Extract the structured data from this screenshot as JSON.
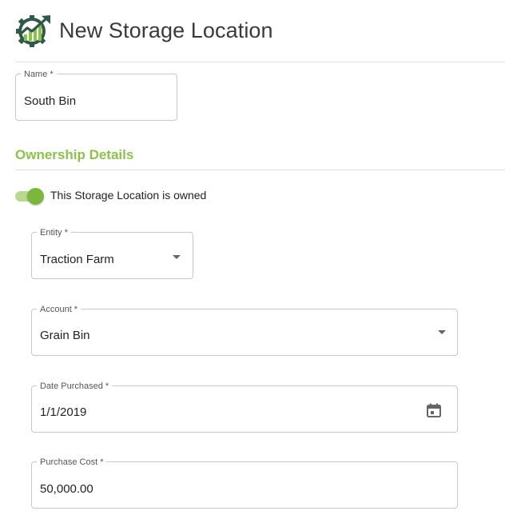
{
  "header": {
    "title": "New Storage Location",
    "logo_icon": "growth-gear-logo"
  },
  "name_field": {
    "label": "Name *",
    "value": "South Bin"
  },
  "ownership": {
    "section_title": "Ownership Details",
    "owned_toggle": {
      "label": "This Storage Location is owned",
      "checked": true
    },
    "entity": {
      "label": "Entity *",
      "value": "Traction Farm",
      "icon": "chevron-down-icon"
    },
    "account": {
      "label": "Account *",
      "value": "Grain Bin",
      "icon": "chevron-down-icon"
    },
    "date_purchased": {
      "label": "Date Purchased *",
      "value": "1/1/2019",
      "icon": "calendar-icon"
    },
    "purchase_cost": {
      "label": "Purchase Cost *",
      "value": "50,000.00"
    }
  },
  "colors": {
    "accent_green": "#8dc14b",
    "toggle_thumb": "#7ab73c",
    "toggle_track": "#b8d98f",
    "logo_dark": "#2f5a4a",
    "border": "#c8c8c8"
  }
}
